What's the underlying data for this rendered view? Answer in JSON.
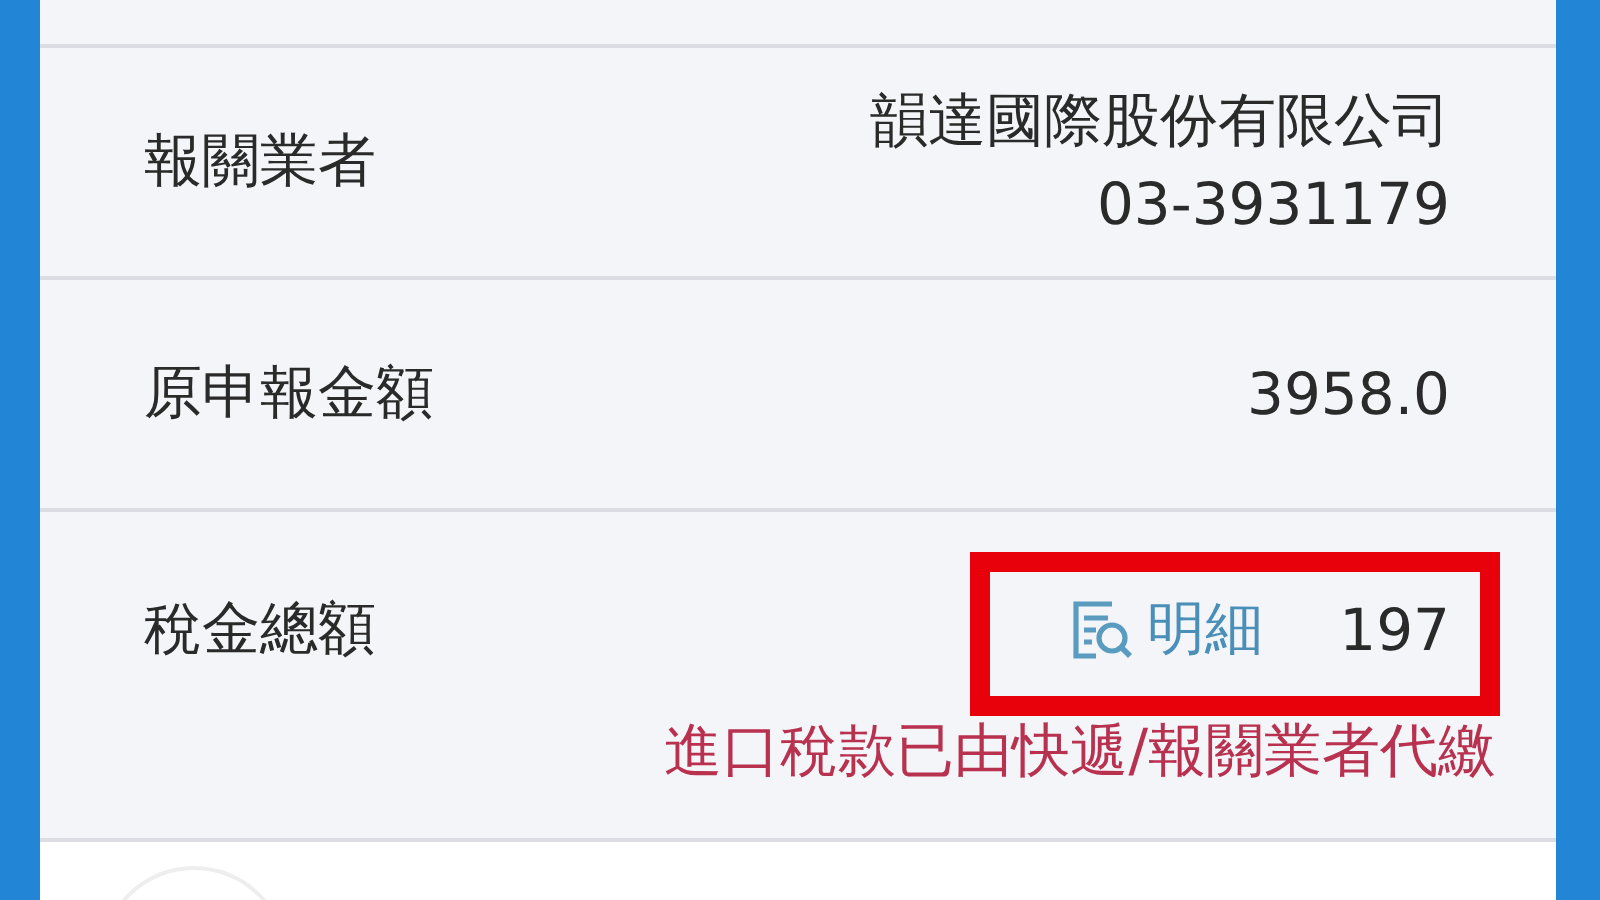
{
  "rows": [
    {
      "label": "報關業者",
      "values": [
        "韻達國際股份有限公司",
        "03-3931179"
      ]
    },
    {
      "label": "原申報金額",
      "values": [
        "3958.0"
      ]
    },
    {
      "label": "稅金總額",
      "values": [
        "197"
      ],
      "detail_link": "明細",
      "note": "進口稅款已由快遞/報關業者代繳"
    }
  ]
}
